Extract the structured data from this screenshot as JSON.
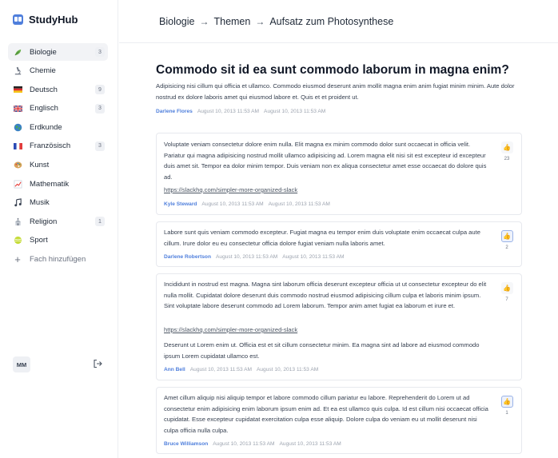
{
  "app": {
    "name": "StudyHub",
    "brand_color": "#4f7fdc"
  },
  "sidebar": {
    "items": [
      {
        "label": "Biologie",
        "icon": "plant-icon",
        "badge": "3",
        "active": true
      },
      {
        "label": "Chemie",
        "icon": "microscope-icon",
        "badge": ""
      },
      {
        "label": "Deutsch",
        "icon": "germany-flag-icon",
        "badge": "9"
      },
      {
        "label": "Englisch",
        "icon": "uk-flag-icon",
        "badge": "3"
      },
      {
        "label": "Erdkunde",
        "icon": "globe-icon",
        "badge": ""
      },
      {
        "label": "Französisch",
        "icon": "france-flag-icon",
        "badge": "3"
      },
      {
        "label": "Kunst",
        "icon": "palette-icon",
        "badge": ""
      },
      {
        "label": "Mathematik",
        "icon": "chart-icon",
        "badge": ""
      },
      {
        "label": "Musik",
        "icon": "music-notes-icon",
        "badge": ""
      },
      {
        "label": "Religion",
        "icon": "place-of-worship-icon",
        "badge": "1"
      },
      {
        "label": "Sport",
        "icon": "ball-icon",
        "badge": ""
      }
    ],
    "add_label": "Fach hinzufügen",
    "user_initials": "MM"
  },
  "breadcrumb": {
    "items": [
      "Biologie",
      "Themen",
      "Aufsatz zum Photosynthese"
    ],
    "separator": "→"
  },
  "question": {
    "title": "Commodo sit id ea sunt commodo laborum in magna enim?",
    "body": "Adipisicing nisi cillum qui officia et ullamco. Commodo eiusmod deserunt anim mollit magna enim anim fugiat minim minim. Aute dolor nostrud ex dolore laboris amet qui eiusmod labore et. Quis et et proident ut.",
    "author": "Darlene Flores",
    "created": "August 10, 2013 11:53 AM",
    "updated": "August 10, 2013 11:53 AM"
  },
  "answers": [
    {
      "text": "Voluptate veniam consectetur dolore enim nulla. Elit magna ex minim commodo dolor sunt occaecat in officia velit. Pariatur qui magna adipisicing nostrud mollit ullamco adipisicing ad. Lorem magna elit nisi sit est excepteur id excepteur duis amet sit. Tempor ea dolor minim tempor. Duis veniam non ex aliqua consectetur amet esse occaecat do dolore quis ad.",
      "link": "https://slackhq.com/simpler-more-organized-slack",
      "text2": "",
      "author": "Kyle Steward",
      "created": "August 10, 2013 11:53 AM",
      "updated": "August 10, 2013 11:53 AM",
      "votes": "23",
      "voted": false
    },
    {
      "text": "Labore sunt quis veniam commodo excepteur. Fugiat magna eu tempor enim duis voluptate enim occaecat culpa aute cillum. Irure dolor eu eu consectetur officia dolore fugiat veniam nulla laboris amet.",
      "link": "",
      "text2": "",
      "author": "Darlene Robertson",
      "created": "August 10, 2013 11:53 AM",
      "updated": "August 10, 2013 11:53 AM",
      "votes": "2",
      "voted": true
    },
    {
      "text": "Incididunt in nostrud est magna. Magna sint laborum officia deserunt excepteur officia ut ut consectetur excepteur do elit nulla mollit. Cupidatat dolore deserunt duis commodo nostrud eiusmod adipisicing cillum culpa et laboris minim ipsum. Sint voluptate labore deserunt commodo ad Lorem laborum. Tempor anim amet fugiat ea laborum et irure et.",
      "link": "https://slackhq.com/simpler-more-organized-slack",
      "text2": "Deserunt ut Lorem enim ut. Officia est et sit cillum consectetur minim. Ea magna sint ad labore ad eiusmod commodo ipsum Lorem cupidatat ullamco est.",
      "author": "Ann Bell",
      "created": "August 10, 2013 11:53 AM",
      "updated": "August 10, 2013 11:53 AM",
      "votes": "7",
      "voted": false
    },
    {
      "text": "Amet cillum aliquip nisi aliquip tempor et labore commodo cillum pariatur eu labore. Reprehenderit do Lorem ut ad consectetur enim adipisicing enim laborum ipsum enim ad. Et ea est ullamco quis culpa. Id est cillum nisi occaecat officia cupidatat. Esse excepteur cupidatat exercitation culpa esse aliquip. Dolore culpa do veniam eu ut mollit deserunt nisi culpa officia nulla culpa.",
      "link": "",
      "text2": "",
      "author": "Bruce Williamson",
      "created": "August 10, 2013 11:53 AM",
      "updated": "August 10, 2013 11:53 AM",
      "votes": "1",
      "voted": true
    }
  ]
}
